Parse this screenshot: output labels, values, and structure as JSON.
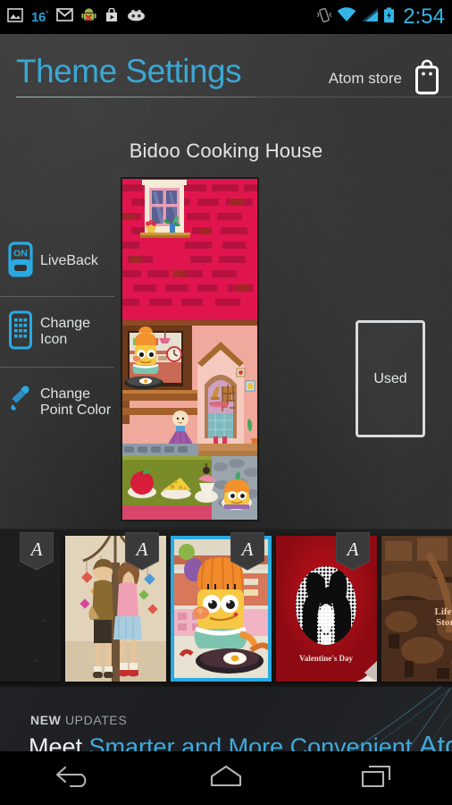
{
  "statusbar": {
    "time": "2:54",
    "temperature": "16",
    "degree": "°",
    "left_icons": [
      "photo-icon",
      "temperature-indicator",
      "gmail-icon",
      "android-sync-error-icon",
      "play-store-icon",
      "cyanogenmod-icon"
    ],
    "right_icons": [
      "vibrate-icon",
      "wifi-icon",
      "cell-signal-icon",
      "battery-charging-icon"
    ],
    "accent_color": "#33b5e5"
  },
  "header": {
    "title": "Theme Settings",
    "store_label": "Atom store",
    "store_icon": "shopping-bag-icon",
    "title_color": "#3ba7d4"
  },
  "theme": {
    "name": "Bidoo Cooking House",
    "used_label": "Used"
  },
  "menu": {
    "items": [
      {
        "label": "LiveBack",
        "icon": "toggle-on-icon",
        "line2": ""
      },
      {
        "label": "Change",
        "line2": "Icon",
        "icon": "phone-grid-icon"
      },
      {
        "label": "Change",
        "line2": "Point Color",
        "icon": "eyedropper-icon"
      }
    ],
    "icon_color": "#29abe2"
  },
  "thumbnails": {
    "selected_index": 2,
    "selected_border_color": "#29abe2",
    "badge_glyph": "A",
    "items": [
      {
        "name": "chalkboard-theme",
        "kind": "chalkboard"
      },
      {
        "name": "kissing-kids-theme",
        "kind": "kids"
      },
      {
        "name": "bidoo-cooking-house-theme",
        "kind": "bidoo",
        "selected": true
      },
      {
        "name": "valentines-day-theme",
        "kind": "valentine",
        "caption": "Valentine's Day"
      },
      {
        "name": "life-is-story-theme",
        "kind": "sepia",
        "caption": "Life is Story"
      }
    ]
  },
  "promo": {
    "eyebrow_strong": "NEW",
    "eyebrow_light": "UPDATES",
    "line_white": "Meet",
    "line_accent": "Smarter and More Convenient",
    "line_brand": "Atom",
    "accent_color": "#3fa9dd"
  },
  "navbar": {
    "buttons": [
      {
        "name": "back",
        "icon": "back-arrow-icon"
      },
      {
        "name": "home",
        "icon": "home-icon"
      },
      {
        "name": "recents",
        "icon": "recents-icon"
      }
    ]
  }
}
